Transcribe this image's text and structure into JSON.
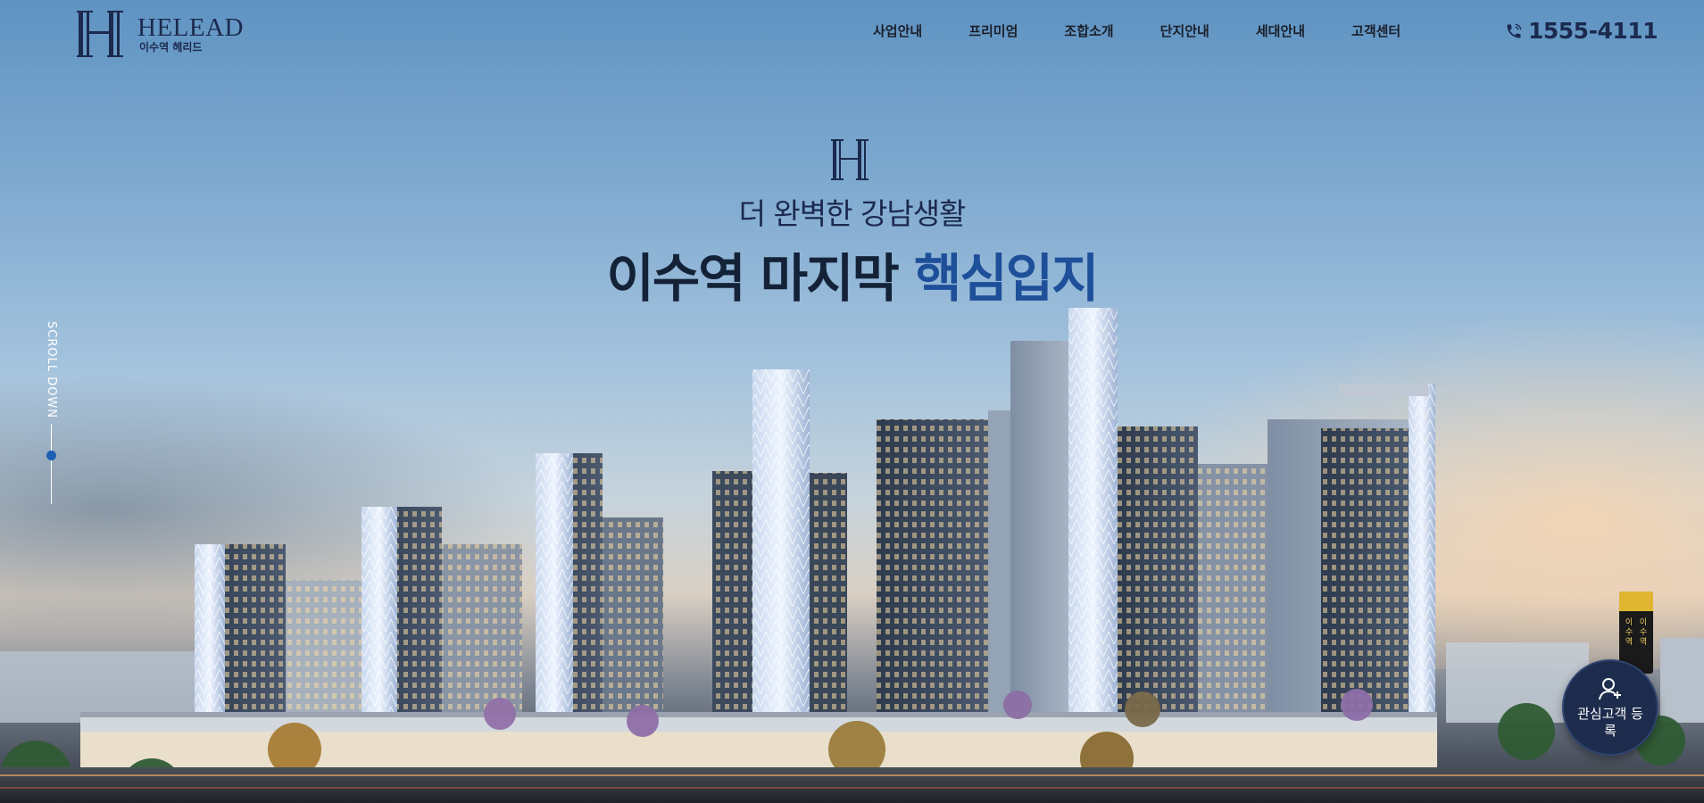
{
  "brand": {
    "logo_en": "HELEAD",
    "logo_ko": "이수역 헤리드"
  },
  "nav": {
    "items": [
      "사업안내",
      "프리미엄",
      "조합소개",
      "단지안내",
      "세대안내",
      "고객센터"
    ]
  },
  "contact": {
    "phone": "1555-4111",
    "icon": "phone-icon"
  },
  "hero": {
    "subtitle": "더 완벽한 강남생활",
    "title_main": "이수역 마지막",
    "title_accent": "핵심입지"
  },
  "scroll": {
    "label": "SCROLL DOWN"
  },
  "register_button": {
    "label": "관심고객 등록",
    "icon": "user-plus-icon"
  },
  "station_sign": {
    "left": "이수역",
    "right": "이수역"
  },
  "colors": {
    "brand_navy": "#1b2a4e",
    "accent_blue": "#1e4f99",
    "scroll_dot": "#1e5fb5",
    "register_bg": "#1d2c4c"
  }
}
